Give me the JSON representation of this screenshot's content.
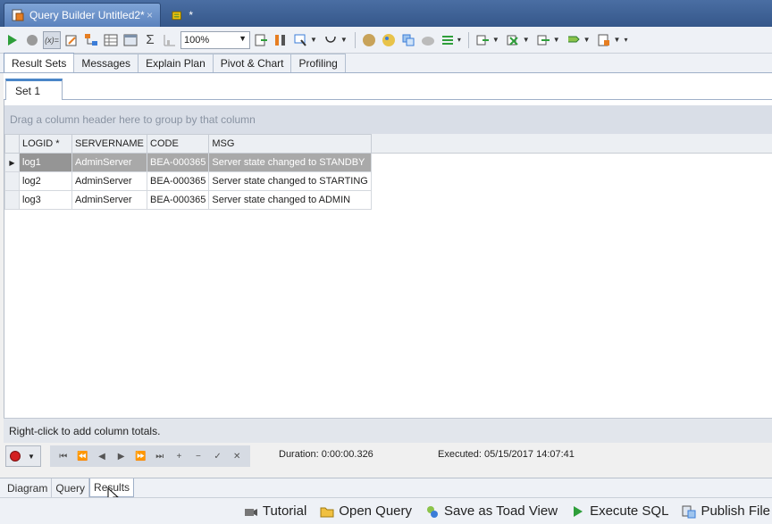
{
  "doc_tabs": {
    "active_label": "Query Builder Untitled2*",
    "close_glyph": "×",
    "second_label": "*"
  },
  "toolbar": {
    "zoom_value": "100%"
  },
  "result_tabs": [
    "Result Sets",
    "Messages",
    "Explain Plan",
    "Pivot & Chart",
    "Profiling"
  ],
  "sub_tab": "Set 1",
  "grid": {
    "group_hint": "Drag a column header here to group by that column",
    "columns": [
      "LOGID *",
      "SERVERNAME",
      "CODE",
      "MSG"
    ],
    "rows": [
      [
        "log1",
        "AdminServer",
        "BEA-000365",
        "Server state changed to STANDBY"
      ],
      [
        "log2",
        "AdminServer",
        "BEA-000365",
        "Server state changed to STARTING"
      ],
      [
        "log3",
        "AdminServer",
        "BEA-000365",
        "Server state changed to ADMIN"
      ]
    ],
    "footer_hint": "Right-click to add column totals."
  },
  "status": {
    "duration": "Duration: 0:00:00.326",
    "executed": "Executed: 05/15/2017 14:07:41"
  },
  "bottom_tabs": [
    "Diagram",
    "Query",
    "Results"
  ],
  "actions": [
    "Tutorial",
    "Open Query",
    "Save as Toad View",
    "Execute SQL",
    "Publish File"
  ],
  "colors": {
    "accent": "#4a6ea3",
    "selected_row": "#a9a9a9",
    "record": "#d32020"
  }
}
